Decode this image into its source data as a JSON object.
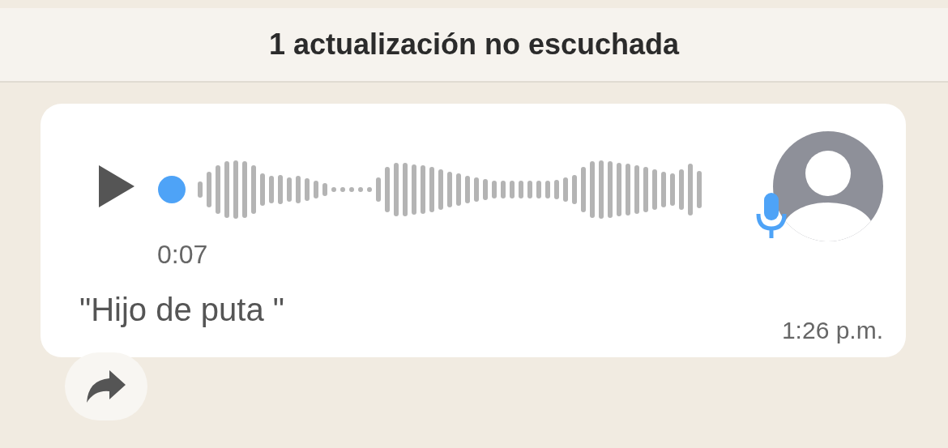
{
  "banner": {
    "text": "1 actualización no escuchada"
  },
  "message": {
    "kind": "voice",
    "level": 0,
    "duration": "0:07",
    "transcript": "\"Hijo de puta \"",
    "time": "1:26 p.m.",
    "unheard": true
  }
}
